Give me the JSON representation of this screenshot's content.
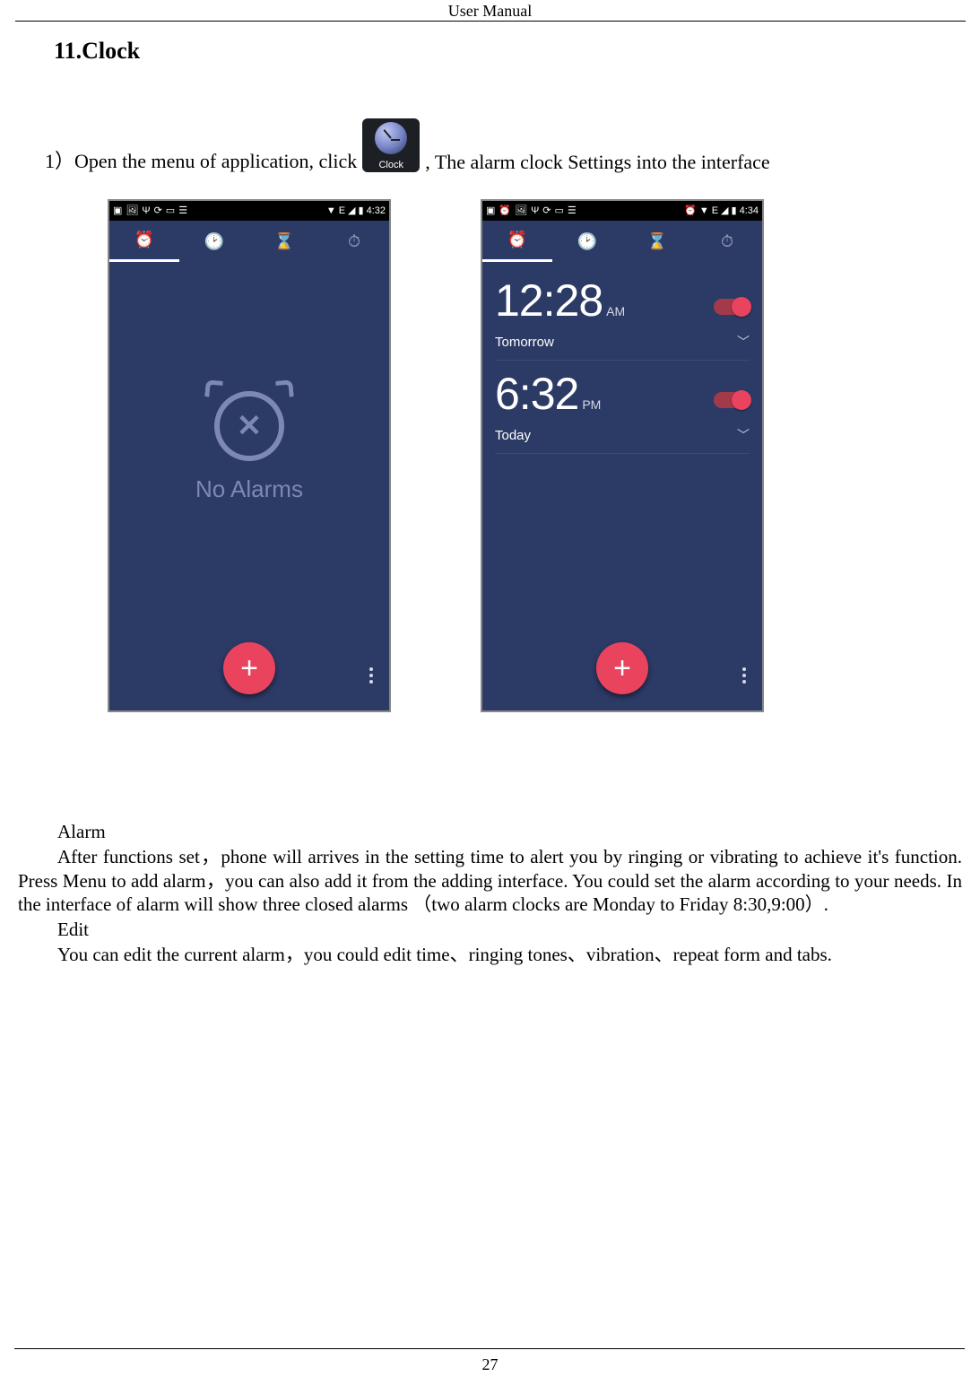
{
  "header": {
    "title": "User    Manual"
  },
  "section": {
    "title": "11.Clock"
  },
  "intro": {
    "pre": "1）Open the menu of application, click ",
    "post": ", The alarm clock Settings into the interface",
    "icon_label": "Clock"
  },
  "status_bar": {
    "left_time": "4:32",
    "right_time": "4:34",
    "signal_text": "E",
    "net_icons": [
      "▼",
      "E",
      "◢",
      "▮"
    ]
  },
  "tabs": {
    "alarm": "⏰",
    "clock": "🕑",
    "timer": "⌛",
    "stopwatch": "⏱"
  },
  "noalarms": {
    "text": "No Alarms"
  },
  "alarms": [
    {
      "time": "12:28",
      "ampm": "AM",
      "day": "Tomorrow"
    },
    {
      "time": "6:32",
      "ampm": "PM",
      "day": "Today"
    }
  ],
  "fab": {
    "plus": "+"
  },
  "body": {
    "h1": "Alarm",
    "p1": "After functions set，phone will arrives in the setting time to alert you by ringing or vibrating to achieve it's function. Press Menu to add alarm，you can also add it from the adding interface. You could set the alarm according to your needs. In the interface of alarm will show three closed alarms （two alarm clocks are Monday to Friday 8:30,9:00）.",
    "h2": "Edit",
    "p2": "You can edit the current alarm，you could edit time、ringing tones、vibration、repeat form and tabs."
  },
  "page_number": "27"
}
